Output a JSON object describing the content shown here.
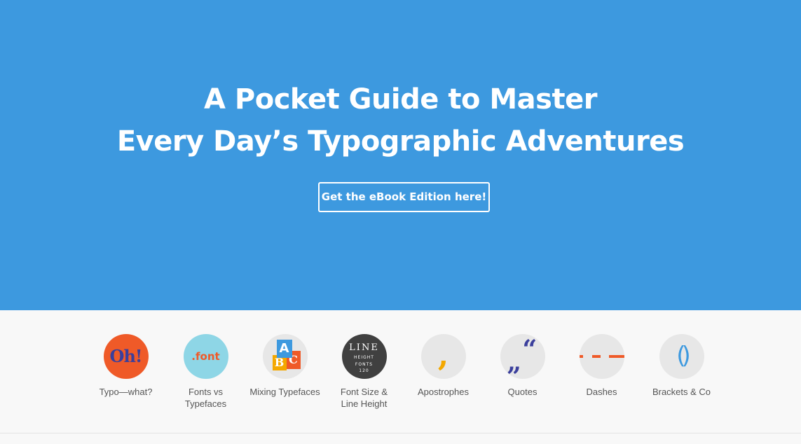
{
  "hero": {
    "title_line1": "A Pocket Guide to Master",
    "title_line2": "Every Day’s Typographic Adventures",
    "cta_label": "Get the eBook Edition here!",
    "background_color": "#3d99df"
  },
  "nav": {
    "items": [
      {
        "label": "Typo—what?",
        "icon": "oh-exclamation-icon",
        "glyph": "Oh!"
      },
      {
        "label_line1": "Fonts vs",
        "label_line2": "Typefaces",
        "icon": "font-icon",
        "glyph": ".font"
      },
      {
        "label": "Mixing Typefaces",
        "icon": "abc-blocks-icon",
        "glyph_a": "A",
        "glyph_b": "B",
        "glyph_c": "C"
      },
      {
        "label_line1": "Font Size &",
        "label_line2": "Line Height",
        "icon": "line-height-icon",
        "glyph_big": "LINE",
        "glyph_mid": "HEIGHT",
        "glyph_small": "FONTS",
        "glyph_num": "120"
      },
      {
        "label": "Apostrophes",
        "icon": "apostrophe-icon",
        "glyph": ","
      },
      {
        "label": "Quotes",
        "icon": "quotes-icon",
        "glyph_low": "„",
        "glyph_high": "“"
      },
      {
        "label": "Dashes",
        "icon": "dashes-icon"
      },
      {
        "label": "Brackets & Co",
        "icon": "brackets-icon",
        "glyph": "()"
      }
    ]
  },
  "colors": {
    "accent_blue": "#3d99df",
    "accent_orange": "#ef5a28",
    "accent_indigo": "#3b3f9c",
    "accent_yellow": "#f4a800",
    "accent_cyan": "#8ed6e6"
  }
}
